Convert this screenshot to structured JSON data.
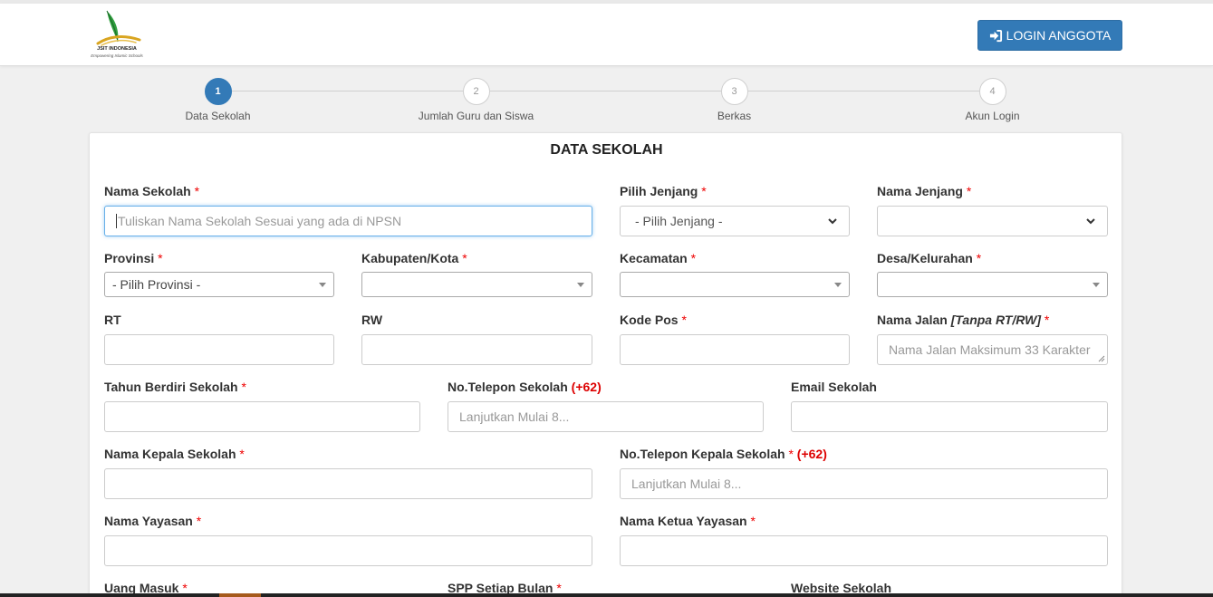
{
  "brand": {
    "name": "JSIT INDONESIA",
    "tagline": "Empowering Islamic Schools"
  },
  "header": {
    "login_label": "LOGIN ANGGOTA"
  },
  "steps": [
    {
      "number": "1",
      "label": "Data Sekolah",
      "active": true
    },
    {
      "number": "2",
      "label": "Jumlah Guru dan Siswa",
      "active": false
    },
    {
      "number": "3",
      "label": "Berkas",
      "active": false
    },
    {
      "number": "4",
      "label": "Akun Login",
      "active": false
    }
  ],
  "form": {
    "title": "DATA SEKOLAH",
    "required_mark": "*",
    "nama_sekolah": {
      "label": "Nama Sekolah",
      "placeholder": "Tuliskan Nama Sekolah Sesuai yang ada di NPSN"
    },
    "pilih_jenjang": {
      "label": "Pilih Jenjang",
      "value": "- Pilih Jenjang -"
    },
    "nama_jenjang": {
      "label": "Nama Jenjang",
      "value": ""
    },
    "provinsi": {
      "label": "Provinsi",
      "value": "- Pilih Provinsi -"
    },
    "kabupaten": {
      "label": "Kabupaten/Kota",
      "value": ""
    },
    "kecamatan": {
      "label": "Kecamatan",
      "value": ""
    },
    "desa": {
      "label": "Desa/Kelurahan",
      "value": ""
    },
    "rt": {
      "label": "RT"
    },
    "rw": {
      "label": "RW"
    },
    "kode_pos": {
      "label": "Kode Pos"
    },
    "nama_jalan": {
      "label": "Nama Jalan",
      "label_note": "[Tanpa RT/RW]",
      "placeholder": "Nama Jalan Maksimum 33 Karakter"
    },
    "tahun_berdiri": {
      "label": "Tahun Berdiri Sekolah"
    },
    "telepon_sekolah": {
      "label": "No.Telepon Sekolah",
      "prefix": "(+62)",
      "placeholder": "Lanjutkan Mulai 8..."
    },
    "email_sekolah": {
      "label": "Email Sekolah"
    },
    "kepala_sekolah": {
      "label": "Nama Kepala Sekolah"
    },
    "telepon_kepala": {
      "label": "No.Telepon Kepala Sekolah",
      "prefix": "(+62)",
      "placeholder": "Lanjutkan Mulai 8..."
    },
    "yayasan": {
      "label": "Nama Yayasan"
    },
    "ketua_yayasan": {
      "label": "Nama Ketua Yayasan"
    },
    "uang_masuk": {
      "label": "Uang Masuk"
    },
    "spp": {
      "label": "SPP Setiap Bulan"
    },
    "website": {
      "label": "Website Sekolah"
    }
  },
  "colors": {
    "primary": "#337ab7",
    "required": "#e00000",
    "page_bg": "#f0f0f0"
  }
}
